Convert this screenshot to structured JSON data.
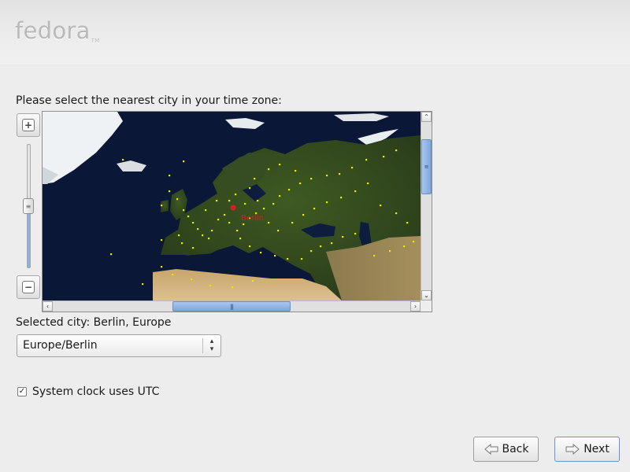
{
  "header": {
    "logo_text": "fedora",
    "logo_mark": "TM"
  },
  "prompt": "Please select the nearest city in your time zone:",
  "map": {
    "selected_marker_label": "Berlin",
    "zoom": {
      "in_icon": "zoom-in-icon",
      "out_icon": "zoom-out-icon",
      "level_fraction": 0.5
    },
    "scroll": {
      "vertical_fraction": 0.15,
      "horizontal_fraction": 0.5
    }
  },
  "selected_city_text": "Selected city: Berlin, Europe",
  "timezone_select": {
    "value": "Europe/Berlin"
  },
  "utc_checkbox": {
    "label": "System clock uses UTC",
    "checked": true
  },
  "buttons": {
    "back": "Back",
    "next": "Next"
  },
  "colors": {
    "accent": "#7ea6dc",
    "marker": "#e8e800",
    "selected_marker": "#d42020",
    "ocean": "#0b1736"
  }
}
